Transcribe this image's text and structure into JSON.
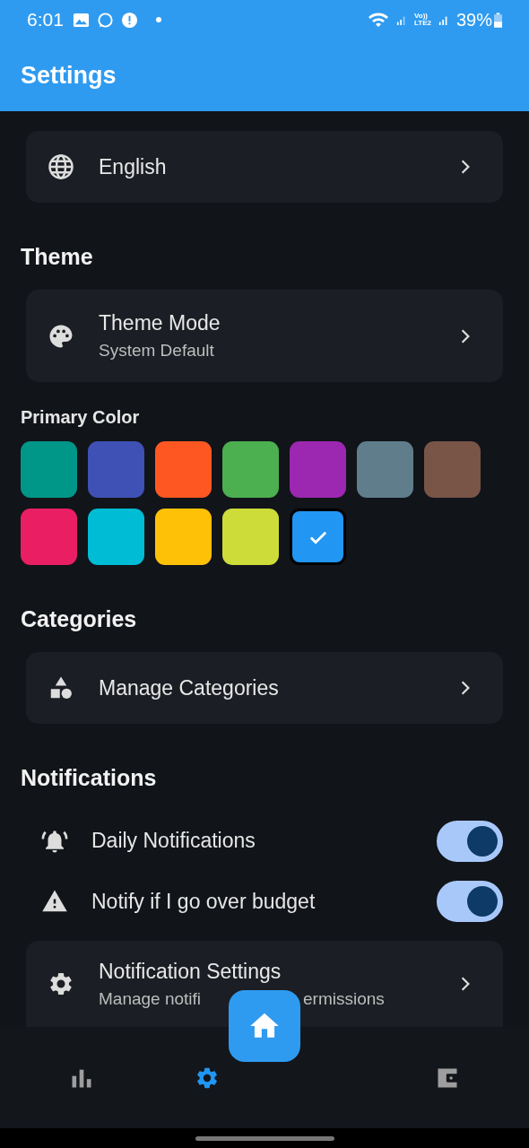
{
  "status_bar": {
    "time": "6:01",
    "network_top": "Vo))",
    "network_bottom": "LTE2",
    "battery": "39%"
  },
  "app_bar": {
    "title": "Settings"
  },
  "language_card": {
    "title": "English"
  },
  "theme": {
    "header": "Theme",
    "mode_title": "Theme Mode",
    "mode_value": "System Default"
  },
  "primary_color": {
    "label": "Primary Color",
    "swatches": [
      {
        "color": "#009688",
        "selected": false
      },
      {
        "color": "#3f51b5",
        "selected": false
      },
      {
        "color": "#ff5722",
        "selected": false
      },
      {
        "color": "#4caf50",
        "selected": false
      },
      {
        "color": "#9c27b0",
        "selected": false
      },
      {
        "color": "#607d8b",
        "selected": false
      },
      {
        "color": "#795548",
        "selected": false
      },
      {
        "color": "#e91e63",
        "selected": false
      },
      {
        "color": "#00bcd4",
        "selected": false
      },
      {
        "color": "#ffc107",
        "selected": false
      },
      {
        "color": "#cddc39",
        "selected": false
      },
      {
        "color": "#2196f3",
        "selected": true
      }
    ]
  },
  "categories": {
    "header": "Categories",
    "title": "Manage Categories"
  },
  "notifications": {
    "header": "Notifications",
    "toggles": [
      {
        "kind": "bell",
        "label": "Daily Notifications",
        "on": true
      },
      {
        "kind": "warning",
        "label": "Notify if I go over budget",
        "on": true
      }
    ],
    "settings_title": "Notification Settings",
    "settings_subtitle_parts": [
      "Manage notifi",
      "ermissions"
    ]
  },
  "bottom_nav": [
    {
      "kind": "stats",
      "selected": false
    },
    {
      "kind": "settings",
      "selected": true
    },
    {
      "kind": "wallet",
      "selected": false
    }
  ]
}
